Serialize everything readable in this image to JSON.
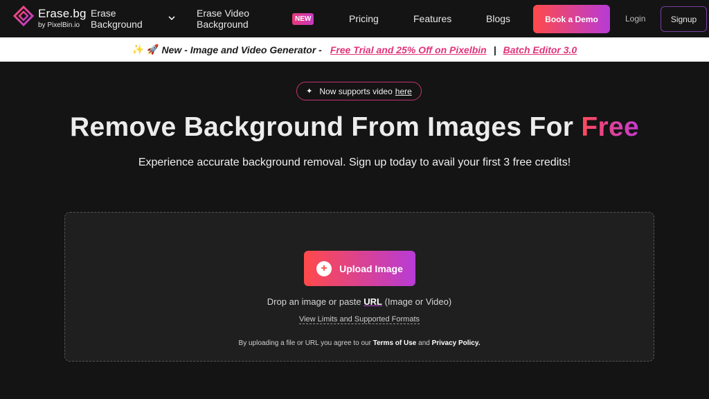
{
  "nav": {
    "logo_title": "Erase.bg",
    "logo_sub": "by PixelBin.io",
    "erase_bg_l1": "Erase",
    "erase_bg_l2": "Background",
    "erase_video_l1": "Erase Video",
    "erase_video_l2": "Background",
    "new_badge": "NEW",
    "pricing": "Pricing",
    "features": "Features",
    "blogs": "Blogs",
    "book_demo": "Book a Demo",
    "login": "Login",
    "signup": "Signup"
  },
  "announcement": {
    "emoji": "✨ 🚀",
    "text": "New - Image and Video Generator -",
    "link1": "Free Trial and 25% Off on Pixelbin",
    "separator": "|",
    "link2": "Batch Editor 3.0"
  },
  "hero": {
    "pill_text": "Now supports video",
    "pill_link": "here",
    "headline_main": "Remove Background From Images For ",
    "headline_accent": "Free",
    "subline": "Experience accurate background removal. Sign up today to avail your first 3 free credits!"
  },
  "upload": {
    "button": "Upload Image",
    "drop_before": "Drop an image or paste ",
    "drop_url": "URL",
    "drop_after": " (Image or Video)",
    "limits": "View Limits and Supported Formats",
    "terms_before": "By uploading a file or URL you agree to our ",
    "terms_link1": "Terms of Use",
    "terms_mid": " and ",
    "terms_link2": "Privacy Policy."
  },
  "colors": {
    "background": "#141414",
    "accent_start": "#ff4a4a",
    "accent_end": "#b73bd6",
    "link_pink": "#e0337a"
  }
}
